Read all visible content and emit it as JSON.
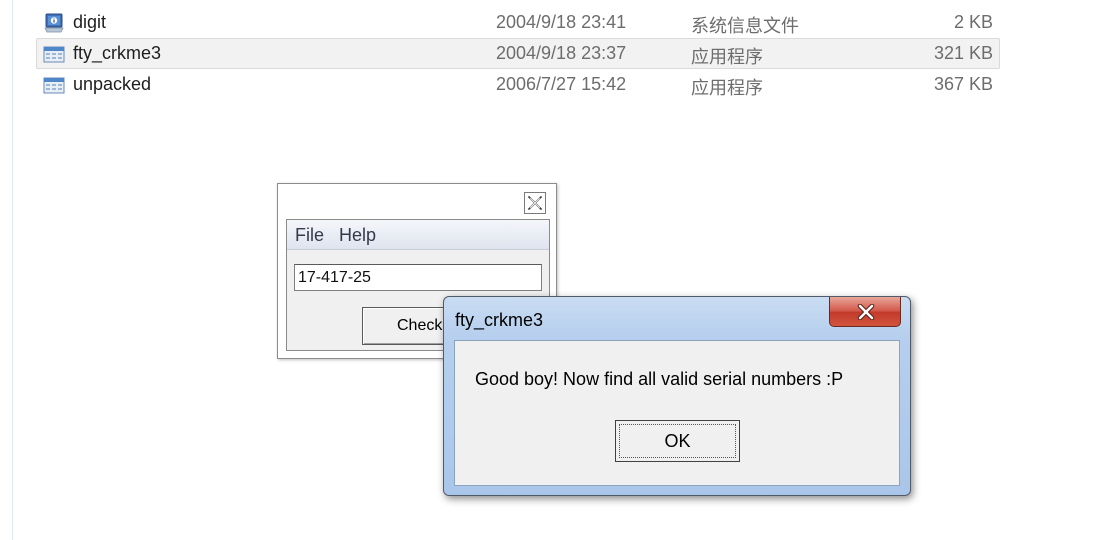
{
  "files": [
    {
      "name": "digit",
      "date": "2004/9/18 23:41",
      "type": "系统信息文件",
      "size": "2 KB",
      "icon": "system-info-file-icon",
      "selected": false
    },
    {
      "name": "fty_crkme3",
      "date": "2004/9/18 23:37",
      "type": "应用程序",
      "size": "321 KB",
      "icon": "application-icon",
      "selected": true
    },
    {
      "name": "unpacked",
      "date": "2006/7/27 15:42",
      "type": "应用程序",
      "size": "367 KB",
      "icon": "application-icon",
      "selected": false
    }
  ],
  "crackme": {
    "menu": [
      "File",
      "Help"
    ],
    "serial_value": "17-417-25",
    "check_label": "Check"
  },
  "msgbox": {
    "title": "fty_crkme3",
    "message": "Good boy! Now find all valid serial numbers :P",
    "ok_label": "OK"
  },
  "colors": {
    "selection_bg": "#f2f2f2",
    "msgbox_frame": "#b6cfee",
    "close_red": "#c23a2a"
  }
}
